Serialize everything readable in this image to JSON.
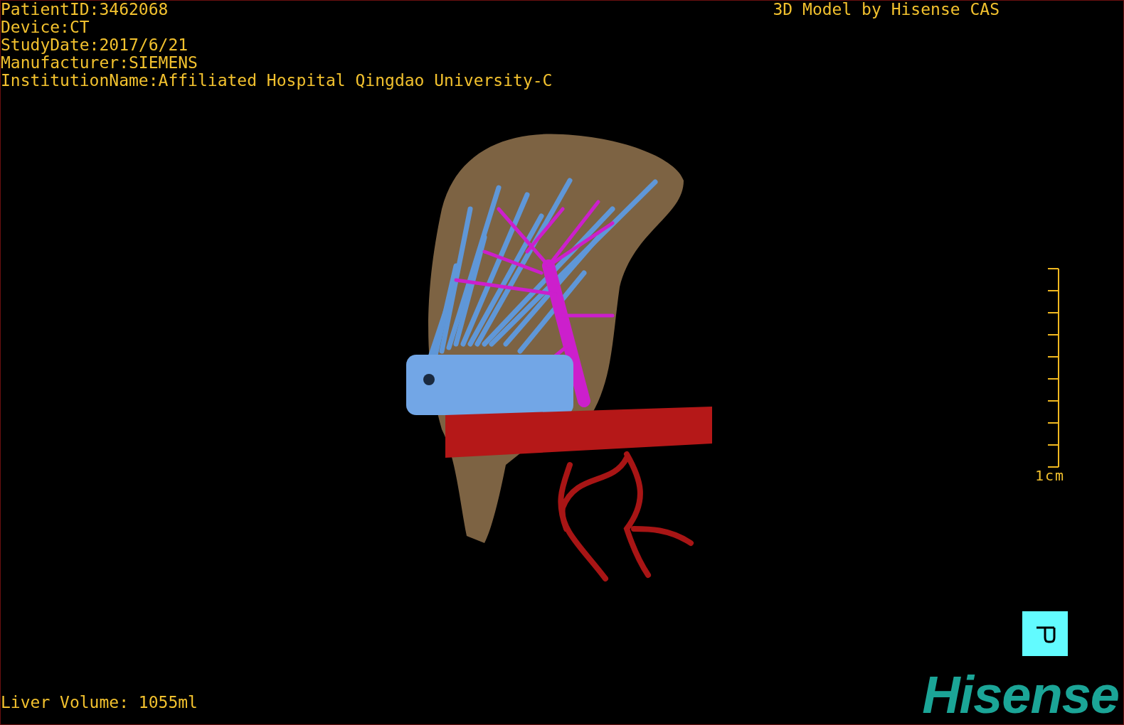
{
  "patient_info": [
    "PatientID:3462068",
    "Device:CT",
    "StudyDate:2017/6/21",
    "Manufacturer:SIEMENS",
    "InstitutionName:Affiliated Hospital Qingdao University-C"
  ],
  "title": "3D Model by Hisense CAS",
  "scale_bar": {
    "label": "1cm"
  },
  "liver_volume": "Liver Volume: 1055ml",
  "logo": "Hisense"
}
